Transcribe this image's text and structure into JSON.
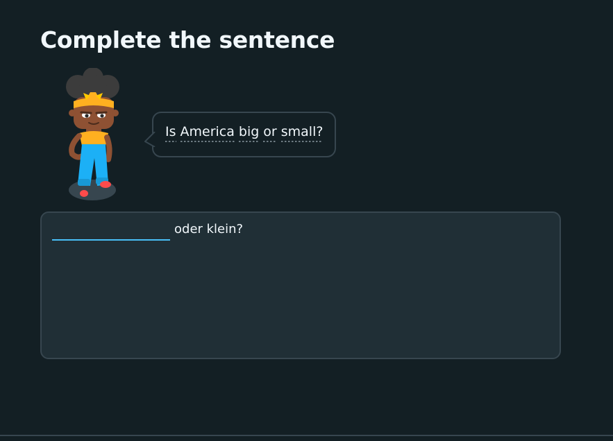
{
  "header": {
    "title": "Complete the sentence"
  },
  "prompt": {
    "words": [
      "Is",
      "America",
      "big",
      "or",
      "small?"
    ]
  },
  "exercise": {
    "blank_value": "",
    "after_blank_text": "oder klein?"
  },
  "colors": {
    "background": "#131f24",
    "card": "#202f36",
    "border": "#37464f",
    "input_underline": "#49c0f8",
    "text": "#f1f7fb"
  },
  "icons": {
    "character": "character-illustration"
  }
}
